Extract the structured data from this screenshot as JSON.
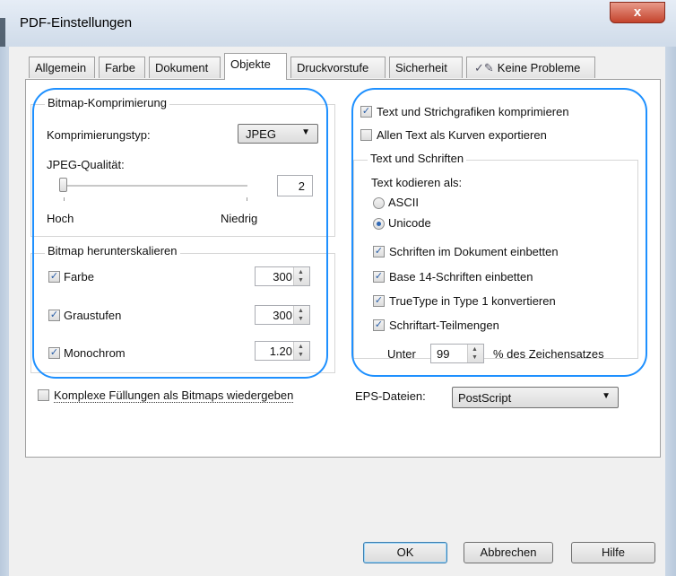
{
  "window": {
    "title": "PDF-Einstellungen",
    "close_label": "x"
  },
  "tabs": [
    "Allgemein",
    "Farbe",
    "Dokument",
    "Objekte",
    "Druckvorstufe",
    "Sicherheit",
    "Keine Probleme"
  ],
  "active_tab": "Objekte",
  "bitmap_compression": {
    "group_label": "Bitmap-Komprimierung",
    "type_label": "Komprimierungstyp:",
    "type_value": "JPEG",
    "quality_label": "JPEG-Qualität:",
    "quality_value": "2",
    "quality_fraction": 0.0,
    "slider_low": "Hoch",
    "slider_high": "Niedrig"
  },
  "downsample": {
    "group_label": "Bitmap herunterskalieren",
    "rows": [
      {
        "label": "Farbe",
        "checked": true,
        "value": "300"
      },
      {
        "label": "Graustufen",
        "checked": true,
        "value": "300"
      },
      {
        "label": "Monochrom",
        "checked": true,
        "value": "1.20"
      }
    ]
  },
  "complex_fills": {
    "label": "Komplexe Füllungen als Bitmaps wiedergeben",
    "checked": false
  },
  "compress_text": {
    "label": "Text und Strichgrafiken komprimieren",
    "checked": true
  },
  "text_as_curves": {
    "label": "Allen Text als Kurven exportieren",
    "checked": false
  },
  "fonts": {
    "group_label": "Text und Schriften",
    "encode_label": "Text kodieren als:",
    "radio_ascii": "ASCII",
    "radio_unicode": "Unicode",
    "selected": "Unicode",
    "embed_fonts": "Schriften im Dokument einbetten",
    "embed_base14": "Base 14-Schriften einbetten",
    "truetype": "TrueType in Type 1 konvertieren",
    "subset": "Schriftart-Teilmengen",
    "subset_under_label": "Unter",
    "subset_value": "99",
    "subset_suffix": "% des Zeichensatzes"
  },
  "eps": {
    "label": "EPS-Dateien:",
    "value": "PostScript"
  },
  "buttons": {
    "ok": "OK",
    "cancel": "Abbrechen",
    "help": "Hilfe"
  },
  "colors": {
    "annotation_oval": "#1e90ff",
    "checkmark": "#2a5fa8"
  }
}
